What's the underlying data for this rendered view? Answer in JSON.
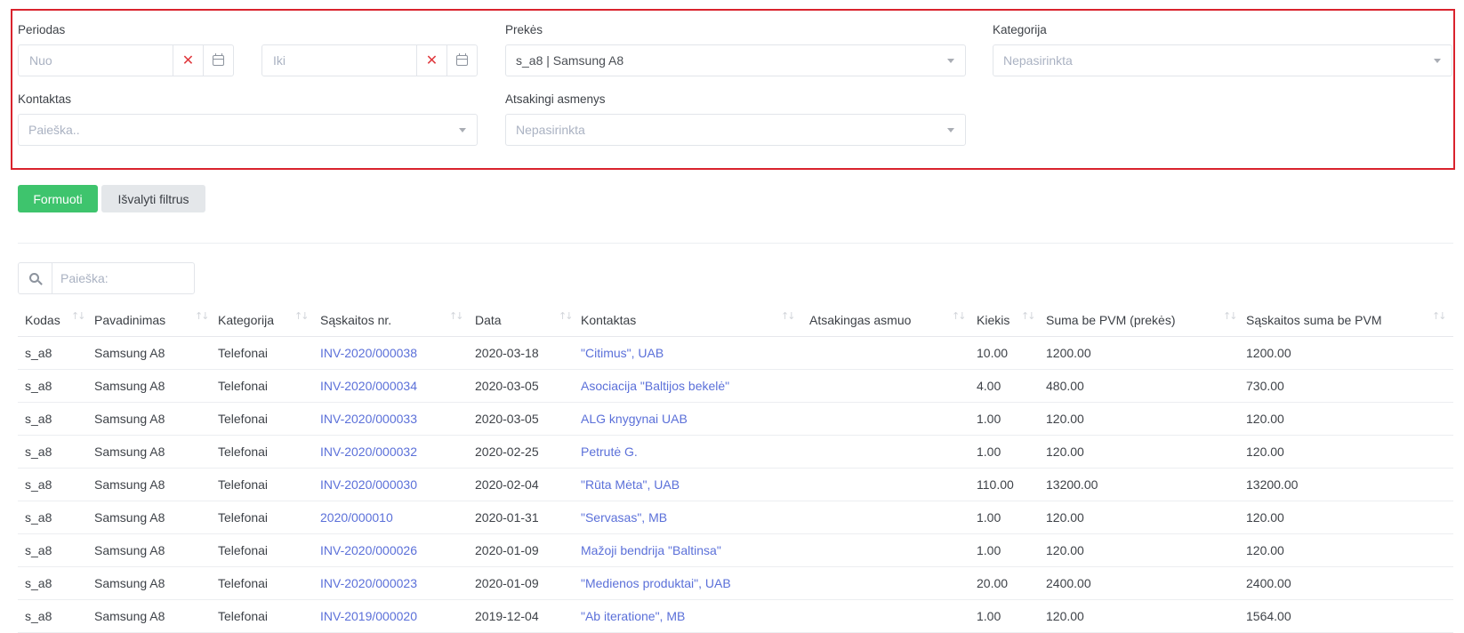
{
  "filters": {
    "periodas": {
      "label": "Periodas",
      "from_placeholder": "Nuo",
      "to_placeholder": "Iki"
    },
    "prekes": {
      "label": "Prekės",
      "value": "s_a8 | Samsung A8"
    },
    "kategorija": {
      "label": "Kategorija",
      "placeholder": "Nepasirinkta"
    },
    "kontaktas": {
      "label": "Kontaktas",
      "placeholder": "Paieška.."
    },
    "atsakingi": {
      "label": "Atsakingi asmenys",
      "placeholder": "Nepasirinkta"
    }
  },
  "actions": {
    "generate_label": "Formuoti",
    "clear_label": "Išvalyti filtrus"
  },
  "search": {
    "placeholder": "Paieška:"
  },
  "table": {
    "columns": [
      "Kodas",
      "Pavadinimas",
      "Kategorija",
      "Sąskaitos nr.",
      "Data",
      "Kontaktas",
      "Atsakingas asmuo",
      "Kiekis",
      "Suma be PVM (prekės)",
      "Sąskaitos suma be PVM"
    ],
    "rows": [
      [
        "s_a8",
        "Samsung A8",
        "Telefonai",
        "INV-2020/000038",
        "2020-03-18",
        "\"Citimus\", UAB",
        "",
        "10.00",
        "1200.00",
        "1200.00"
      ],
      [
        "s_a8",
        "Samsung A8",
        "Telefonai",
        "INV-2020/000034",
        "2020-03-05",
        "Asociacija \"Baltijos bekelė\"",
        "",
        "4.00",
        "480.00",
        "730.00"
      ],
      [
        "s_a8",
        "Samsung A8",
        "Telefonai",
        "INV-2020/000033",
        "2020-03-05",
        "ALG knygynai UAB",
        "",
        "1.00",
        "120.00",
        "120.00"
      ],
      [
        "s_a8",
        "Samsung A8",
        "Telefonai",
        "INV-2020/000032",
        "2020-02-25",
        "Petrutė G.",
        "",
        "1.00",
        "120.00",
        "120.00"
      ],
      [
        "s_a8",
        "Samsung A8",
        "Telefonai",
        "INV-2020/000030",
        "2020-02-04",
        "\"Rūta Mėta\", UAB",
        "",
        "110.00",
        "13200.00",
        "13200.00"
      ],
      [
        "s_a8",
        "Samsung A8",
        "Telefonai",
        "2020/000010",
        "2020-01-31",
        "\"Servasas\", MB",
        "",
        "1.00",
        "120.00",
        "120.00"
      ],
      [
        "s_a8",
        "Samsung A8",
        "Telefonai",
        "INV-2020/000026",
        "2020-01-09",
        "Mažoji bendrija \"Baltinsa\"",
        "",
        "1.00",
        "120.00",
        "120.00"
      ],
      [
        "s_a8",
        "Samsung A8",
        "Telefonai",
        "INV-2020/000023",
        "2020-01-09",
        "\"Medienos produktai\", UAB",
        "",
        "20.00",
        "2400.00",
        "2400.00"
      ],
      [
        "s_a8",
        "Samsung A8",
        "Telefonai",
        "INV-2019/000020",
        "2019-12-04",
        "\"Ab iteratione\", MB",
        "",
        "1.00",
        "120.00",
        "1564.00"
      ]
    ]
  }
}
